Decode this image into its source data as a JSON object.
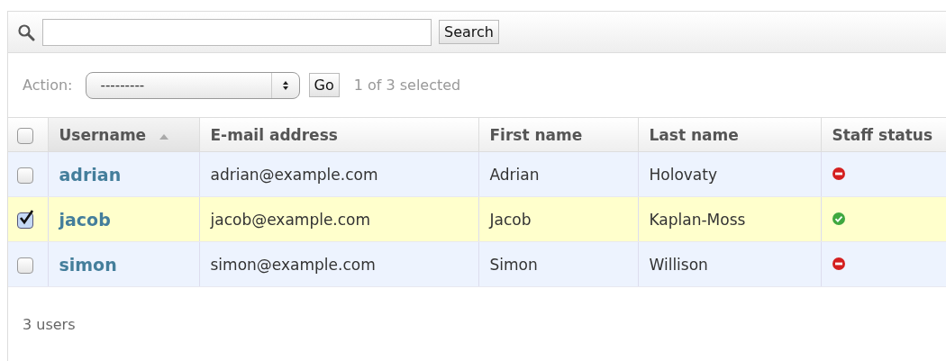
{
  "search": {
    "button": "Search"
  },
  "actions": {
    "label": "Action:",
    "value": "---------",
    "go": "Go",
    "counter": "1 of 3 selected"
  },
  "table": {
    "select_all": false,
    "columns": [
      {
        "label": "Username",
        "sorted": true
      },
      {
        "label": "E-mail address",
        "sorted": false
      },
      {
        "label": "First name",
        "sorted": false
      },
      {
        "label": "Last name",
        "sorted": false
      },
      {
        "label": "Staff status",
        "sorted": false
      }
    ],
    "rows": [
      {
        "selected": false,
        "username": "adrian",
        "email": "adrian@example.com",
        "first_name": "Adrian",
        "last_name": "Holovaty",
        "staff": false
      },
      {
        "selected": true,
        "username": "jacob",
        "email": "jacob@example.com",
        "first_name": "Jacob",
        "last_name": "Kaplan-Moss",
        "staff": true
      },
      {
        "selected": false,
        "username": "simon",
        "email": "simon@example.com",
        "first_name": "Simon",
        "last_name": "Willison",
        "staff": false
      }
    ]
  },
  "footer": "3 users"
}
